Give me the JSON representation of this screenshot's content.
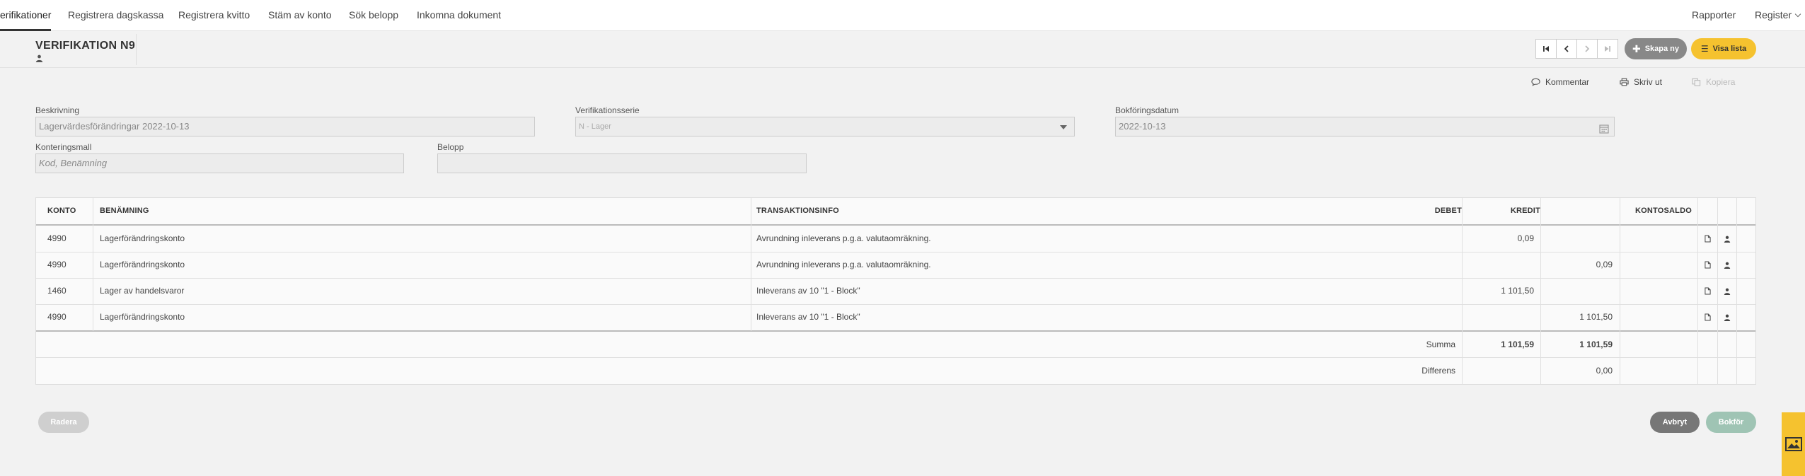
{
  "topnav": {
    "tabs": [
      {
        "label": "erifikationer",
        "active": true
      },
      {
        "label": "Registrera dagskassa"
      },
      {
        "label": "Registrera kvitto"
      },
      {
        "label": "Stäm av konto"
      },
      {
        "label": "Sök belopp"
      },
      {
        "label": "Inkomna dokument"
      }
    ],
    "right": [
      {
        "label": "Rapporter"
      },
      {
        "label": "Register"
      }
    ]
  },
  "header": {
    "title": "VERIFIKATION N9",
    "buttons": {
      "create_new": "Skapa ny",
      "show_list": "Visa lista"
    }
  },
  "toolbar": {
    "comment": "Kommentar",
    "print": "Skriv ut",
    "copy": "Kopiera"
  },
  "form": {
    "description": {
      "label": "Beskrivning",
      "value": "Lagervärdesförändringar 2022-10-13"
    },
    "series": {
      "label": "Verifikationsserie",
      "value": "N - Lager"
    },
    "date": {
      "label": "Bokföringsdatum",
      "value": "2022-10-13"
    },
    "template": {
      "label": "Konteringsmall",
      "placeholder": "Kod, Benämning"
    },
    "amount": {
      "label": "Belopp",
      "value": ""
    }
  },
  "table": {
    "headers": {
      "account": "KONTO",
      "name": "BENÄMNING",
      "info": "TRANSAKTIONSINFO",
      "debit": "DEBET",
      "credit": "KREDIT",
      "balance": "KONTOSALDO"
    },
    "rows": [
      {
        "account": "4990",
        "name": "Lagerförändringskonto",
        "info": "Avrundning inleverans p.g.a. valutaomräkning.",
        "debit": "0,09",
        "credit": ""
      },
      {
        "account": "4990",
        "name": "Lagerförändringskonto",
        "info": "Avrundning inleverans p.g.a. valutaomräkning.",
        "debit": "",
        "credit": "0,09"
      },
      {
        "account": "1460",
        "name": "Lager av handelsvaror",
        "info": "Inleverans av 10 \"1 - Block\"",
        "debit": "1 101,50",
        "credit": ""
      },
      {
        "account": "4990",
        "name": "Lagerförändringskonto",
        "info": "Inleverans av 10 \"1 - Block\"",
        "debit": "",
        "credit": "1 101,50"
      }
    ],
    "sum": {
      "label": "Summa",
      "debit": "1 101,59",
      "credit": "1 101,59"
    },
    "diff": {
      "label": "Differens",
      "credit": "0,00"
    }
  },
  "footer": {
    "delete": "Radera",
    "cancel": "Avbryt",
    "book": "Bokför"
  },
  "colors": {
    "accent_yellow": "#f5c22f",
    "button_grey": "#888888",
    "button_dark": "#777777",
    "button_green_disabled": "#9fc4b4"
  }
}
